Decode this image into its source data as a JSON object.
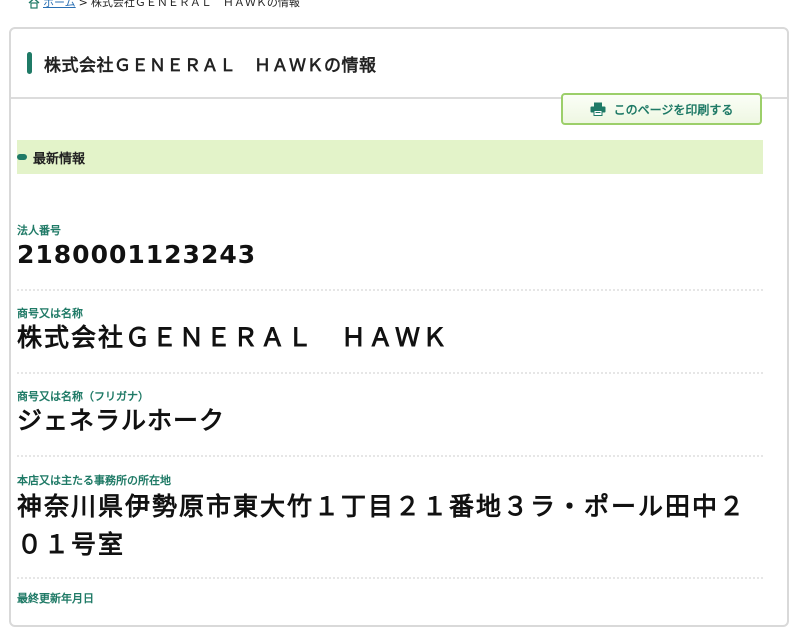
{
  "breadcrumb": {
    "home": "ホーム",
    "separator": ">",
    "current": "株式会社ＧＥＮＥＲＡＬ　ＨＡＷＫの情報"
  },
  "header": {
    "title": "株式会社ＧＥＮＥＲＡＬ　ＨＡＷＫの情報"
  },
  "toolbar": {
    "print_label": "このページを印刷する"
  },
  "section": {
    "title": "最新情報"
  },
  "fields": [
    {
      "label": "法人番号",
      "value": "2180001123243"
    },
    {
      "label": "商号又は名称",
      "value": "株式会社ＧＥＮＥＲＡＬ　ＨＡＷＫ"
    },
    {
      "label": "商号又は名称（フリガナ）",
      "value": "ジェネラルホーク"
    },
    {
      "label": "本店又は主たる事務所の所在地",
      "value": "神奈川県伊勢原市東大竹１丁目２１番地３ラ・ポール田中２０１号室"
    },
    {
      "label": "最終更新年月日",
      "value": ""
    }
  ],
  "colors": {
    "accent": "#1f7a66",
    "band": "#e3f3c9",
    "button_border": "#9ccf6a",
    "link": "#2a6fb3"
  },
  "icons": [
    "home-icon",
    "printer-icon"
  ]
}
